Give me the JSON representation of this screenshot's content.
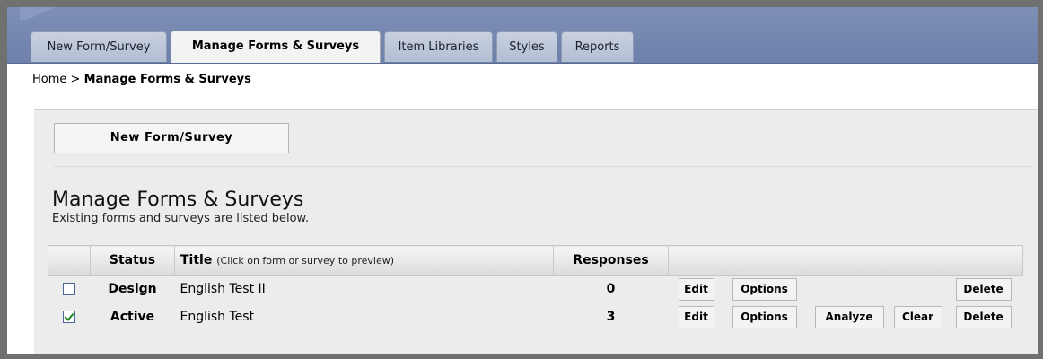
{
  "tabs": [
    {
      "label": "New Form/Survey",
      "active": false
    },
    {
      "label": "Manage Forms & Surveys",
      "active": true
    },
    {
      "label": "Item Libraries",
      "active": false
    },
    {
      "label": "Styles",
      "active": false
    },
    {
      "label": "Reports",
      "active": false
    }
  ],
  "breadcrumb": {
    "home": "Home",
    "separator": ">",
    "current": "Manage Forms & Surveys"
  },
  "toolbar": {
    "new_label": "New Form/Survey"
  },
  "page": {
    "title": "Manage Forms & Surveys",
    "subtitle": "Existing forms and surveys are listed below."
  },
  "table": {
    "headers": {
      "status": "Status",
      "title": "Title",
      "title_hint": "(Click on form or survey to preview)",
      "responses": "Responses"
    },
    "rows": [
      {
        "checked": false,
        "status": "Design",
        "title": "English Test II",
        "responses": "0",
        "actions": {
          "edit": "Edit",
          "options": "Options",
          "delete": "Delete"
        }
      },
      {
        "checked": true,
        "status": "Active",
        "title": "English Test",
        "responses": "3",
        "actions": {
          "edit": "Edit",
          "options": "Options",
          "analyze": "Analyze",
          "clear": "Clear",
          "delete": "Delete"
        }
      }
    ]
  },
  "colors": {
    "tabbar": "#6d81ac",
    "panel": "#ececec",
    "check": "#1f8a1f"
  }
}
